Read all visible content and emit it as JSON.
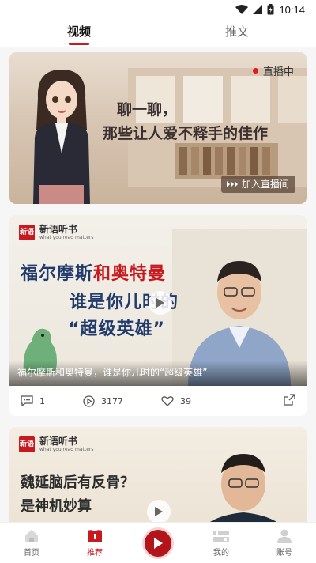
{
  "status": {
    "time": "10:14",
    "icons": [
      "wifi-icon",
      "signal-icon",
      "battery-icon"
    ]
  },
  "top_tabs": [
    {
      "label": "视频",
      "active": true
    },
    {
      "label": "推文",
      "active": false
    }
  ],
  "live_card": {
    "badge": "直播中",
    "title_line1": "聊一聊，",
    "title_line2": "那些让人爱不释手的佳作",
    "join_label": "加入直播间"
  },
  "video_card": {
    "brand_name": "新语听书",
    "brand_sub": "what you read matters",
    "brand_logo": "新语",
    "title_line1_a": "福尔摩斯",
    "title_line1_b": "和",
    "title_line1_c": "奥特曼",
    "title_line2": "谁是你儿时的",
    "title_line3": "“超级英雄”",
    "caption": "福尔摩斯和奥特曼，谁是你儿时的“超级英雄”",
    "comments": "1",
    "plays": "3177",
    "likes": "39"
  },
  "video_card2": {
    "brand_name": "新语听书",
    "brand_sub": "what you read matters",
    "brand_logo": "新语",
    "title_line1": "魏延脑后有反骨？",
    "title_line2": "是神机妙算"
  },
  "bottom_nav": [
    {
      "label": "首页",
      "icon": "home-icon",
      "active": false
    },
    {
      "label": "推荐",
      "icon": "recommend-icon",
      "active": true
    },
    {
      "label": "我的",
      "icon": "bookshelf-icon",
      "active": false
    },
    {
      "label": "账号",
      "icon": "account-icon",
      "active": false
    }
  ],
  "colors": {
    "accent": "#c8191e",
    "title_blue": "#1f3a6b"
  }
}
